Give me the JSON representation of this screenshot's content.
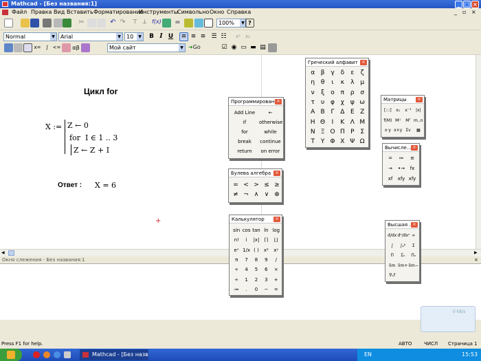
{
  "window": {
    "title": "Mathcad - [Без названия:1]"
  },
  "menu": [
    "Файл",
    "Правка",
    "Вид",
    "Вставить",
    "Форматирование",
    "Инструменты",
    "Символьно",
    "Окно",
    "Справка"
  ],
  "toolbar2": {
    "style": "Normal",
    "font": "Arial",
    "size": "10"
  },
  "toolbar1": {
    "zoom": "100%"
  },
  "toolbar3": {
    "site": "Мой сайт",
    "go": "Go"
  },
  "document": {
    "heading": "Цикл  for",
    "program": {
      "var": "X :=",
      "line1": "Z ← 0",
      "line2_kw": "for",
      "line2": "I ∈ 1 .. 3",
      "line3": "Z ← Z + I"
    },
    "answer_label": "Ответ :",
    "answer": "X = 6"
  },
  "palettes": {
    "programming": {
      "title": "Программирование",
      "buttons": [
        "Add Line",
        "←",
        "if",
        "otherwise",
        "for",
        "while",
        "break",
        "continue",
        "return",
        "on error"
      ]
    },
    "boolean": {
      "title": "Булева алгебра",
      "buttons": [
        "=",
        "<",
        ">",
        "≤",
        "≥",
        "≠",
        "¬",
        "∧",
        "∨",
        "⊕"
      ]
    },
    "calculator": {
      "title": "Калькулятор",
      "buttons": [
        "sin",
        "cos",
        "tan",
        "ln",
        "log",
        "n!",
        "i",
        "|x|",
        "⌈⌉",
        "⌊⌋",
        "eˣ",
        "1/x",
        "( )",
        "x²",
        "xʸ",
        "π",
        "7",
        "8",
        "9",
        "/",
        "÷",
        "4",
        "5",
        "6",
        "×",
        "÷",
        "1",
        "2",
        "3",
        "+",
        "≔",
        ".",
        "0",
        "−",
        "="
      ]
    },
    "greek": {
      "title": "Греческий алфавит",
      "letters": [
        "α",
        "β",
        "γ",
        "δ",
        "ε",
        "ζ",
        "η",
        "θ",
        "ι",
        "κ",
        "λ",
        "μ",
        "ν",
        "ξ",
        "ο",
        "π",
        "ρ",
        "σ",
        "τ",
        "υ",
        "φ",
        "χ",
        "ψ",
        "ω",
        "Α",
        "Β",
        "Γ",
        "Δ",
        "Ε",
        "Ζ",
        "Η",
        "Θ",
        "Ι",
        "Κ",
        "Λ",
        "Μ",
        "Ν",
        "Ξ",
        "Ο",
        "Π",
        "Ρ",
        "Σ",
        "Τ",
        "Υ",
        "Φ",
        "Χ",
        "Ψ",
        "Ω"
      ]
    },
    "matrices": {
      "title": "Матрицы",
      "buttons": [
        "[:::]",
        "x₁",
        "x⁻¹",
        "|x|",
        "f(M)",
        "M⁽⁾",
        "Mᵀ",
        "m..n",
        "x·y",
        "x×y",
        "Σv",
        "▦"
      ]
    },
    "evaluation": {
      "title": "Вычисле...",
      "buttons": [
        "=",
        "≔",
        "≡",
        "→",
        "•→",
        "fx",
        "xf",
        "xfy",
        "xfy"
      ]
    },
    "calculus": {
      "title": "Высшая ...",
      "buttons": [
        "d/dx",
        "dⁿ/dxⁿ",
        "∞",
        "∫",
        "∫ₐᵇ",
        "Σ",
        "Π",
        "Σₙ",
        "Πₙ",
        "lim",
        "lim+",
        "lim−",
        "∇ₓf"
      ]
    }
  },
  "trace_window": {
    "title": "Окно слежения - Без названия:1"
  },
  "status": {
    "help": "Press F1 for help.",
    "mode": "АВТО",
    "caps": "ЧИСЛ",
    "page": "Страница 1",
    "net": "0 kB/s"
  },
  "taskbar": {
    "task": "Mathcad - [Без назв...",
    "lang": "EN",
    "time": "15:53"
  }
}
